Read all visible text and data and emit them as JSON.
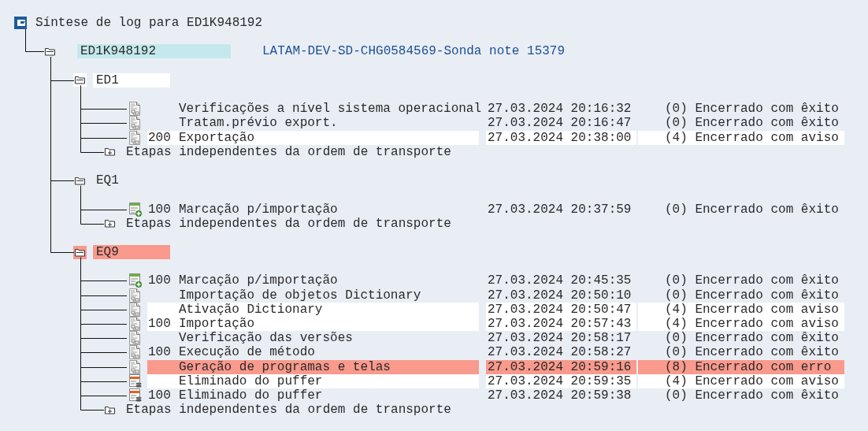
{
  "title": "Síntese de log para ED1K948192",
  "request": {
    "id": "ED1K948192",
    "selected": true,
    "description": "LATAM-DEV-SD-CHG0584569-Sonda note 15379",
    "systems": [
      {
        "name": "ED1",
        "color": "#ffffff",
        "steps": [
          {
            "kind": "document",
            "name": "Verificações a nível sistema operacional",
            "date": "27.03.2024 20:16:32",
            "status": "(0) Encerrado com êxito"
          },
          {
            "kind": "document",
            "name": "Tratam.prévio export.",
            "date": "27.03.2024 20:16:47",
            "status": "(0) Encerrado com êxito"
          },
          {
            "kind": "document",
            "number": "200",
            "name": "Exportação",
            "date": "27.03.2024 20:38:00",
            "status": "(4) Encerrado com aviso",
            "color": "#ffffff"
          }
        ],
        "footer": "Etapas independentes da ordem de transporte"
      },
      {
        "name": "EQ1",
        "steps": [
          {
            "kind": "import",
            "number": "100",
            "name": "Marcação p/importação",
            "date": "27.03.2024 20:37:59",
            "status": "(0) Encerrado com êxito"
          }
        ],
        "footer": "Etapas independentes da ordem de transporte"
      },
      {
        "name": "EQ9",
        "color": "#f99a8d",
        "steps": [
          {
            "kind": "import",
            "number": "100",
            "name": "Marcação p/importação",
            "date": "27.03.2024 20:45:35",
            "status": "(0) Encerrado com êxito"
          },
          {
            "kind": "document",
            "name": "Importação de objetos Dictionary",
            "date": "27.03.2024 20:50:10",
            "status": "(0) Encerrado com êxito"
          },
          {
            "kind": "document",
            "name": "Ativação Dictionary",
            "date": "27.03.2024 20:50:47",
            "status": "(4) Encerrado com aviso",
            "color": "#ffffff"
          },
          {
            "kind": "document",
            "number": "100",
            "name": "Importação",
            "date": "27.03.2024 20:57:43",
            "status": "(4) Encerrado com aviso",
            "color": "#ffffff"
          },
          {
            "kind": "document",
            "name": "Verificação das versões",
            "date": "27.03.2024 20:58:17",
            "status": "(0) Encerrado com êxito"
          },
          {
            "kind": "document",
            "number": "100",
            "name": "Execução de método",
            "date": "27.03.2024 20:58:27",
            "status": "(0) Encerrado com êxito"
          },
          {
            "kind": "document",
            "name": "Geração de programas e telas",
            "date": "27.03.2024 20:59:16",
            "status": "(8) Encerrado com erro",
            "color": "#f99a8d"
          },
          {
            "kind": "buffer",
            "name": "Eliminado do puffer",
            "date": "27.03.2024 20:59:35",
            "status": "(4) Encerrado com aviso",
            "color": "#ffffff"
          },
          {
            "kind": "buffer",
            "number": "100",
            "name": "Eliminado do puffer",
            "date": "27.03.2024 20:59:38",
            "status": "(0) Encerrado com êxito"
          }
        ],
        "footer": "Etapas independentes da ordem de transporte"
      }
    ]
  }
}
